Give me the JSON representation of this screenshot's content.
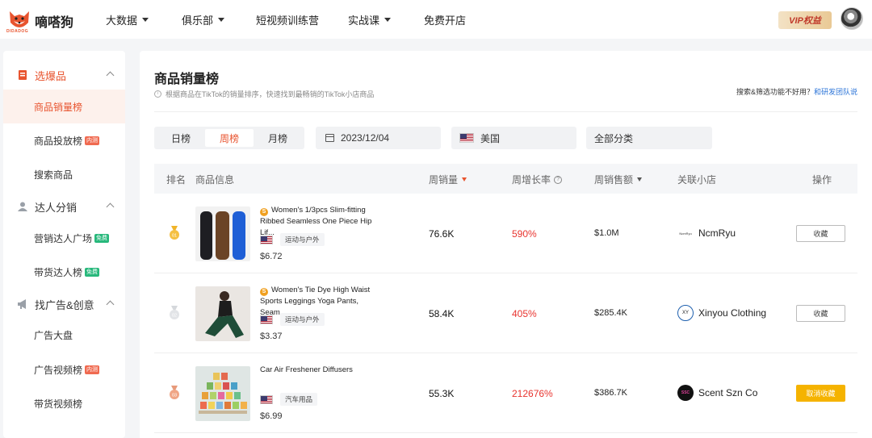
{
  "brand": {
    "name": "嘀嗒狗",
    "sub": "DIDADOG"
  },
  "nav": [
    {
      "label": "大数据",
      "has_caret": true
    },
    {
      "label": "俱乐部",
      "has_caret": true
    },
    {
      "label": "短视频训练营",
      "has_caret": false
    },
    {
      "label": "实战课",
      "has_caret": true
    },
    {
      "label": "免费开店",
      "has_caret": false
    }
  ],
  "vip_label": "VIP权益",
  "sidebar": {
    "groups": [
      {
        "label": "选爆品",
        "items": [
          {
            "label": "商品销量榜",
            "badge": ""
          },
          {
            "label": "商品投放榜",
            "badge": "内测"
          },
          {
            "label": "搜索商品",
            "badge": ""
          }
        ]
      },
      {
        "label": "达人分销",
        "items": [
          {
            "label": "营销达人广场",
            "badge": "免费"
          },
          {
            "label": "带货达人榜",
            "badge": "免费"
          }
        ]
      },
      {
        "label": "找广告&创意",
        "items": [
          {
            "label": "广告大盘",
            "badge": ""
          },
          {
            "label": "广告视频榜",
            "badge": "内测"
          },
          {
            "label": "带货视频榜",
            "badge": ""
          }
        ]
      }
    ]
  },
  "main": {
    "title": "商品销量榜",
    "subtitle": "根据商品在TikTok的销量排序，快速找到最畅销的TikTok小店商品",
    "feedback_text": "搜索&筛选功能不好用？",
    "feedback_link": "和研发团队说",
    "tabs": [
      "日榜",
      "周榜",
      "月榜"
    ],
    "active_tab": "周榜",
    "date": "2023/12/04",
    "country": "美国",
    "category": "全部分类"
  },
  "table": {
    "headers": {
      "rank": "排名",
      "product": "商品信息",
      "sales": "周销量",
      "growth": "周增长率",
      "revenue": "周销售额",
      "shop": "关联小店",
      "action": "操作"
    },
    "rows": [
      {
        "rank": "01",
        "name": "Women's 1/3pcs Slim-fitting Ribbed Seamless One Piece Hip Lif...",
        "category": "运动与户外",
        "price": "$6.72",
        "sales": "76.6K",
        "growth": "590%",
        "revenue": "$1.0M",
        "shop": "NcmRyu",
        "shop_logo_text": "NcmRyu",
        "action": "收藏",
        "collected": false
      },
      {
        "rank": "02",
        "name": "Women's Tie Dye High Waist Sports Leggings Yoga Pants, Seam...",
        "category": "运动与户外",
        "price": "$3.37",
        "sales": "58.4K",
        "growth": "405%",
        "revenue": "$285.4K",
        "shop": "Xinyou Clothing",
        "shop_logo_text": "XY",
        "action": "收藏",
        "collected": false
      },
      {
        "rank": "03",
        "name": "Car Air Freshener Diffusers",
        "category": "汽车用品",
        "price": "$6.99",
        "sales": "55.3K",
        "growth": "212676%",
        "revenue": "$386.7K",
        "shop": "Scent Szn Co",
        "shop_logo_text": "SSC",
        "action": "取消收藏",
        "collected": true
      }
    ]
  },
  "colors": {
    "accent": "#e8542f",
    "growth": "#e8342f",
    "gold_button": "#f5b300"
  }
}
